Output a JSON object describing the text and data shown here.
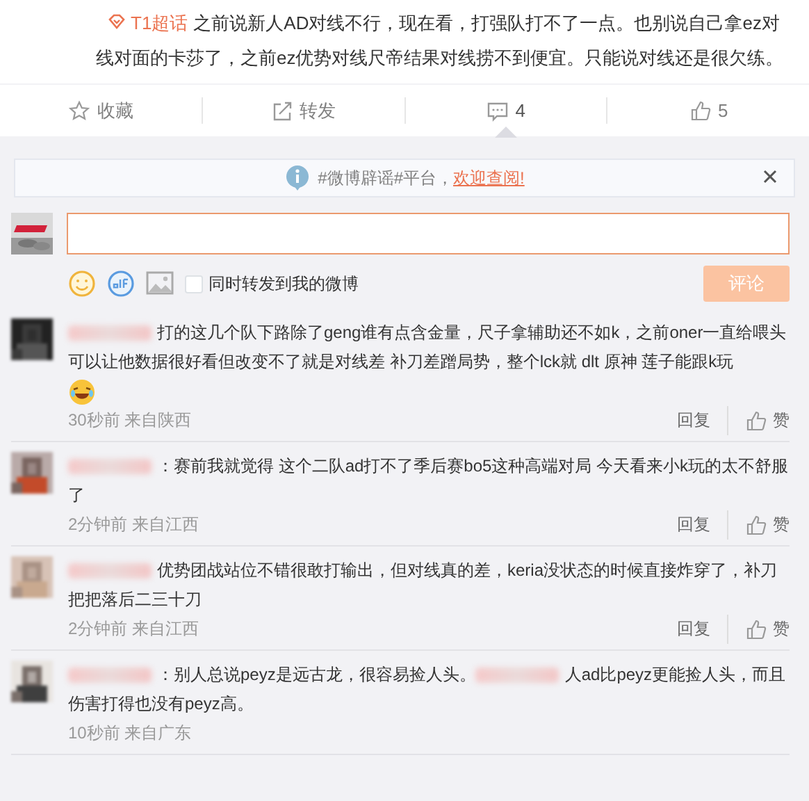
{
  "post": {
    "topic": "T1超话",
    "text": "之前说新人AD对线不行，现在看，打强队打不了一点。也别说自己拿ez对线对面的卡莎了，之前ez优势对线尺帝结果对线捞不到便宜。只能说对线还是很欠练。",
    "actions": [
      {
        "kind": "favorite",
        "label": "收藏",
        "selected": false
      },
      {
        "kind": "repost",
        "label": "转发",
        "selected": false
      },
      {
        "kind": "comment",
        "label": "4",
        "selected": true
      },
      {
        "kind": "like",
        "label": "5",
        "selected": false
      }
    ]
  },
  "notice": {
    "text": "#微博辟谣#平台，",
    "link": "欢迎查阅!"
  },
  "composer": {
    "sync_label": "同时转发到我的微博",
    "sync_checked": false,
    "submit": "评论",
    "submit_disabled": true
  },
  "comments": [
    {
      "parts": [
        {
          "kind": "blur"
        },
        {
          "kind": "text",
          "text": "打的这几个队下路除了geng谁有点含金量，尺子拿辅助还不如k，之前oner一直给喂头可以让他数据很好看但改变不了就是对线差 补刀差蹭局势，整个lck就 dlt 原神 莲子能跟k玩"
        },
        {
          "kind": "emoji"
        }
      ],
      "time": "30秒前 来自陕西",
      "reply": "回复",
      "like": "赞"
    },
    {
      "parts": [
        {
          "kind": "blur"
        },
        {
          "kind": "text",
          "text": "：赛前我就觉得 这个二队ad打不了季后赛bo5这种高端对局 今天看来小k玩的太不舒服了"
        }
      ],
      "time": "2分钟前 来自江西",
      "reply": "回复",
      "like": "赞"
    },
    {
      "parts": [
        {
          "kind": "blur"
        },
        {
          "kind": "text",
          "text": "优势团战站位不错很敢打输出，但对线真的差，keria没状态的时候直接炸穿了，补刀把把落后二三十刀"
        }
      ],
      "time": "2分钟前 来自江西",
      "reply": "回复",
      "like": "赞"
    },
    {
      "parts": [
        {
          "kind": "blur"
        },
        {
          "kind": "text",
          "text": "：别人总说peyz是远古龙，很容易捡人头。"
        },
        {
          "kind": "blur"
        },
        {
          "kind": "text",
          "text": "人ad比peyz更能捡人头，而且伤害打得也没有peyz高。"
        }
      ],
      "time": "10秒前 来自广东"
    }
  ]
}
